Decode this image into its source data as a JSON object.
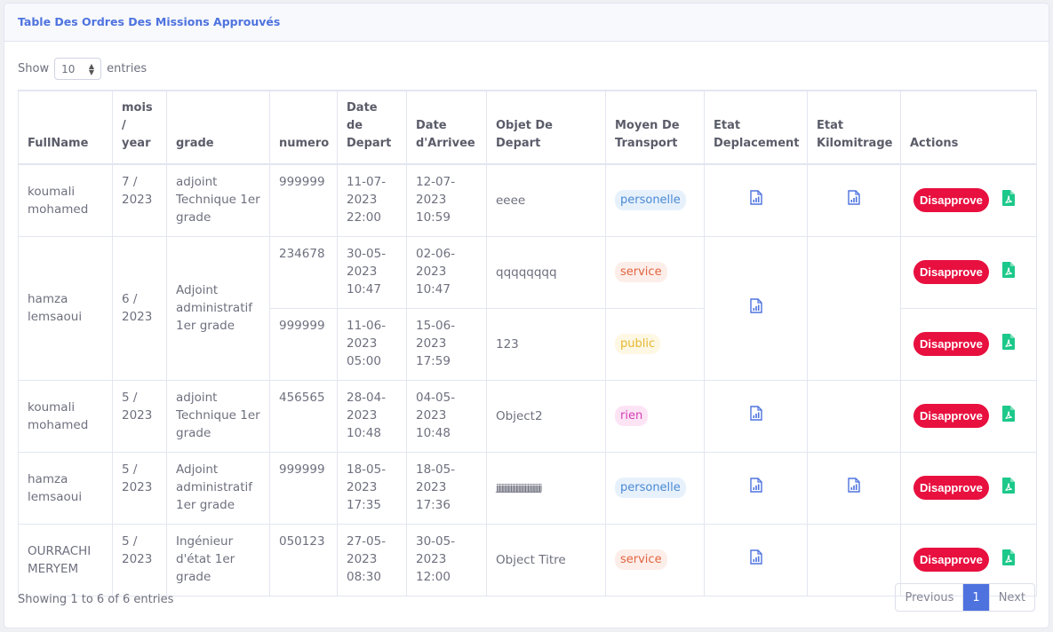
{
  "card": {
    "title": "Table Des Ordres Des Missions Approuvés"
  },
  "length": {
    "show": "Show",
    "value": "10",
    "entries": "entries"
  },
  "columns": [
    "FullName",
    "mois / year",
    "grade",
    "numero",
    "Date de Depart",
    "Date d'Arrivee",
    "Objet De Depart",
    "Moyen De Transport",
    "Etat Deplacement",
    "Etat Kilomitrage",
    "Actions"
  ],
  "rows": [
    {
      "fullname": "koumali mohamed",
      "period": "7 / 2023",
      "grade": "adjoint Technique 1er grade",
      "numero": "999999",
      "depart": "11-07-2023 22:00",
      "arrivee": "12-07-2023 10:59",
      "objet": "eeee",
      "transport": "personelle"
    },
    {
      "fullname": "hamza lemsaoui",
      "period": "6 / 2023",
      "grade": "Adjoint administratif 1er grade",
      "numero": "234678",
      "depart": "30-05-2023 10:47",
      "arrivee": "02-06-2023 10:47",
      "objet": "qqqqqqqq",
      "transport": "service"
    },
    {
      "numero": "999999",
      "depart": "11-06-2023 05:00",
      "arrivee": "15-06-2023 17:59",
      "objet": "123",
      "transport": "public"
    },
    {
      "fullname": "koumali mohamed",
      "period": "5 / 2023",
      "grade": "adjoint Technique 1er grade",
      "numero": "456565",
      "depart": "28-04-2023 10:48",
      "arrivee": "04-05-2023 10:48",
      "objet": "Object2",
      "transport": "rien"
    },
    {
      "fullname": "hamza lemsaoui",
      "period": "5 / 2023",
      "grade": "Adjoint administratif 1er grade",
      "numero": "999999",
      "depart": "18-05-2023 17:35",
      "arrivee": "18-05-2023 17:36",
      "objet": "jjjjjjjjjjjjjjjjjjjjjjjjjjjjjjjjjjj",
      "transport": "personelle"
    },
    {
      "fullname": "OURRACHI MERYEM",
      "period": "5 / 2023",
      "grade": "Ingénieur d'état 1er grade",
      "numero": "050123",
      "depart": "27-05-2023 08:30",
      "arrivee": "30-05-2023 12:00",
      "objet": "Object Titre",
      "transport": "service"
    }
  ],
  "actions": {
    "disapprove": "Disapprove"
  },
  "icons": {
    "report": "file-chart-icon",
    "pdf": "file-pdf-icon"
  },
  "colors": {
    "accent": "#4e73df",
    "danger": "#e8103f",
    "pdf": "#1cc88a"
  },
  "footer": {
    "info": "Showing 1 to 6 of 6 entries"
  },
  "pagination": {
    "previous": "Previous",
    "page": "1",
    "next": "Next"
  }
}
